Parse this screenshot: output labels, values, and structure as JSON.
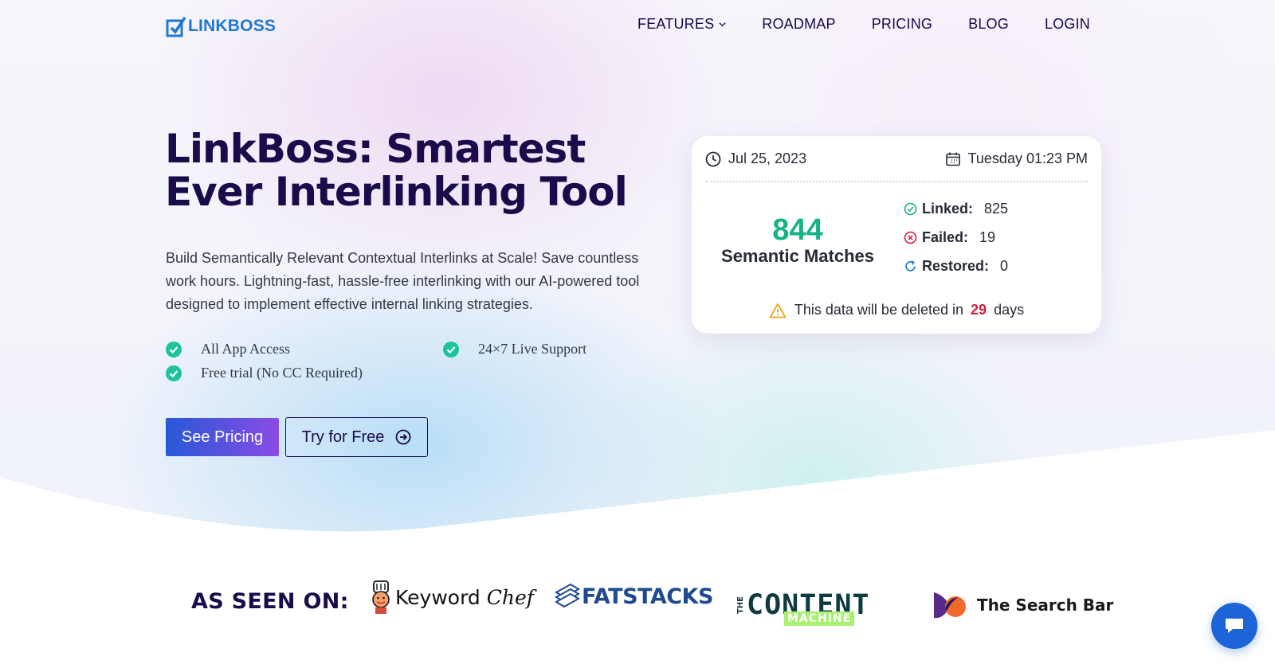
{
  "header": {
    "logo_text": "LINKBOSS",
    "nav": [
      {
        "label": "FEATURES",
        "has_dropdown": true
      },
      {
        "label": "ROADMAP"
      },
      {
        "label": "PRICING"
      },
      {
        "label": "BLOG"
      },
      {
        "label": "LOGIN"
      }
    ]
  },
  "hero": {
    "title": "LinkBoss: Smartest Ever Interlinking Tool",
    "subtitle": "Build Semantically Relevant Contextual Interlinks at Scale! Save countless work hours. Lightning-fast, hassle-free interlinking with our AI-powered tool designed to implement effective internal linking strategies.",
    "features": [
      "All App Access",
      "24×7 Live Support",
      "Free trial (No CC Required)"
    ],
    "primary_button": "See Pricing",
    "secondary_button": "Try for Free"
  },
  "stats_card": {
    "date": "Jul 25, 2023",
    "day_time": "Tuesday 01:23 PM",
    "matches_count": "844",
    "matches_label": "Semantic Matches",
    "linked_label": "Linked:",
    "linked_value": "825",
    "failed_label": "Failed:",
    "failed_value": "19",
    "restored_label": "Restored:",
    "restored_value": "0",
    "warning_prefix": "This data will be deleted in",
    "warning_days": "29",
    "warning_suffix": "days"
  },
  "seen_on": {
    "label": "AS SEEN ON:",
    "brands": {
      "keyword_chef_main": "Keyword",
      "keyword_chef_script": "Chef",
      "fatstacks": "FATSTACKS",
      "content_machine_the": "THE",
      "content_machine_main": "CONTENT",
      "content_machine_sub": "MACHINE",
      "search_bar": "The Search Bar"
    }
  },
  "colors": {
    "brand_blue": "#1e78d2",
    "heading": "#1a0b4b",
    "accent_green": "#16b28a",
    "danger_red": "#d3203f",
    "chat_blue": "#1d64d8"
  }
}
